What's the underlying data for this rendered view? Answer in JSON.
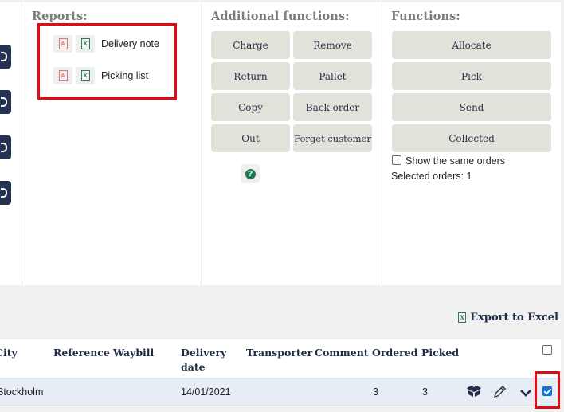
{
  "reports": {
    "title": "Reports:",
    "items": [
      {
        "label": "Delivery note",
        "pdf_icon": "pdf-icon",
        "excel_icon": "excel-icon"
      },
      {
        "label": "Picking list",
        "pdf_icon": "pdf-icon",
        "excel_icon": "excel-icon"
      }
    ]
  },
  "additional_functions": {
    "title": "Additional functions:",
    "buttons": [
      "Charge",
      "Remove",
      "Return",
      "Pallet",
      "Copy",
      "Back order",
      "Out",
      "Forget customer"
    ],
    "help_icon": "?"
  },
  "functions": {
    "title": "Functions:",
    "buttons": [
      "Allocate",
      "Pick",
      "Send",
      "Collected"
    ],
    "show_same_orders_label": "Show the same orders",
    "show_same_orders_checked": false,
    "selected_orders_text": "Selected orders: 1"
  },
  "export": {
    "label": "Export to Excel",
    "icon_glyph": "X"
  },
  "table": {
    "columns": [
      "City",
      "Reference",
      "Waybill",
      "Delivery date",
      "Transporter",
      "Comment",
      "Ordered",
      "Picked"
    ],
    "select_all_checked": false,
    "rows": [
      {
        "city": "Stockholm",
        "reference": "",
        "waybill": "",
        "delivery_date": "14/01/2021",
        "transporter": "",
        "comment": "",
        "ordered": "3",
        "picked": "3",
        "checked": true
      }
    ]
  },
  "icons": {
    "pdf": "A",
    "excel": "X"
  },
  "colors": {
    "accent_red": "#e30b13",
    "nav_button": "#243352",
    "function_button": "#e2e1da",
    "row_highlight": "#e6edf4",
    "checkbox_blue": "#0b6fe0"
  }
}
